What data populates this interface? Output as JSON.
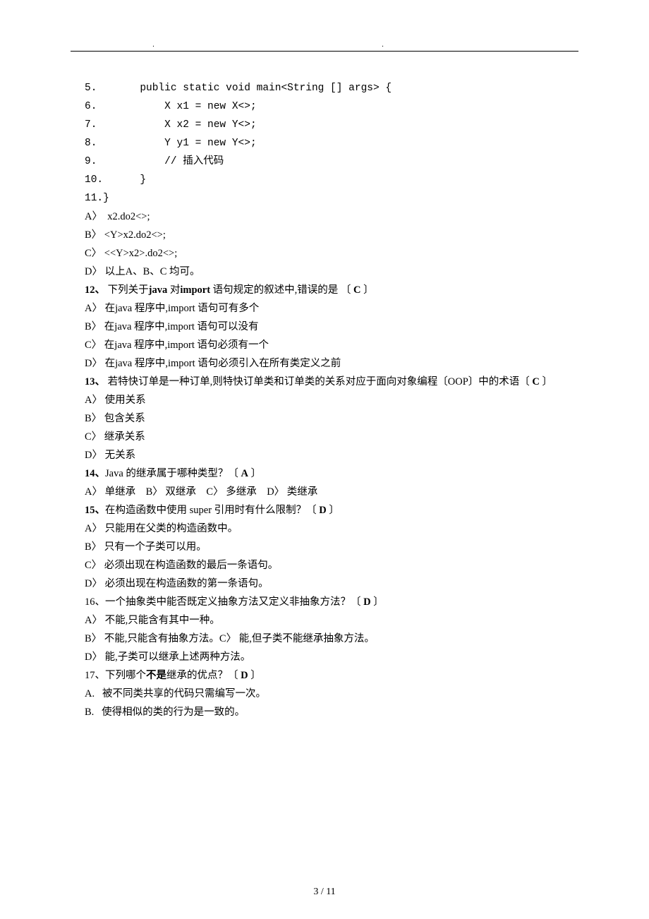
{
  "header_dots": ".  .",
  "code": {
    "l5": "5.       public static void main<String [] args> {",
    "l6": "6.           X x1 = new X<>;",
    "l7": "7.           X x2 = new Y<>;",
    "l8": "8.           Y y1 = new Y<>;",
    "l9": "9.           // 插入代码",
    "l10": "10.      }",
    "l11": "11.}",
    "a": "A〉  x2.do2<>;",
    "b": "B〉 <Y>x2.do2<>;",
    "c": "C〉 <<Y>x2>.do2<>;",
    "d": "D〉 以上A、B、C 均可。"
  },
  "q12": {
    "num": "12、",
    "text1": " 下列关于",
    "kw1": "java",
    "text2": " 对",
    "kw2": "import",
    "text3": " 语句规定的叙述中,错误的是 〔 ",
    "ans": "C",
    "text4": " 〕",
    "a": "A〉 在java 程序中,import 语句可有多个",
    "b": "B〉 在java 程序中,import 语句可以没有",
    "c": "C〉 在java 程序中,import 语句必须有一个",
    "d": "D〉 在java 程序中,import 语句必须引入在所有类定义之前"
  },
  "q13": {
    "num": "13、",
    "text1": " 若特快订单是一种订单,则特快订单类和订单类的关系对应于面向对象编程〔OOP〕中的术语〔 ",
    "ans": "C",
    "text2": " 〕",
    "a": "A〉 使用关系",
    "b": "B〉 包含关系",
    "c": "C〉 继承关系",
    "d": "D〉 无关系"
  },
  "q14": {
    "num": "14、",
    "text1": "Java 的继承属于哪种类型？〔 ",
    "ans": "A",
    "text2": " 〕",
    "opts": "A〉 单继承    B〉 双继承    C〉 多继承    D〉 类继承"
  },
  "q15": {
    "num": "15、",
    "text1": "在构造函数中使用 super 引用时有什么限制？〔 ",
    "ans": "D",
    "text2": " 〕",
    "a": "A〉 只能用在父类的构造函数中。",
    "b": "B〉 只有一个子类可以用。",
    "c": "C〉 必须出现在构造函数的最后一条语句。",
    "d": "D〉 必须出现在构造函数的第一条语句。"
  },
  "q16": {
    "text1": "16、一个抽象类中能否既定义抽象方法又定义非抽象方法？〔 ",
    "ans": "D",
    "text2": " 〕",
    "a": "A〉 不能,只能含有其中一种。",
    "b": "B〉 不能,只能含有抽象方法。C〉 能,但子类不能继承抽象方法。",
    "d": "D〉 能,子类可以继承上述两种方法。"
  },
  "q17": {
    "text1": "17、下列哪个",
    "kw": "不是",
    "text2": "继承的优点？〔 ",
    "ans": "D",
    "text3": " 〕",
    "a": "A.   被不同类共享的代码只需编写一次。",
    "b": "B.   使得相似的类的行为是一致的。"
  },
  "pagenum": "3 / 11"
}
